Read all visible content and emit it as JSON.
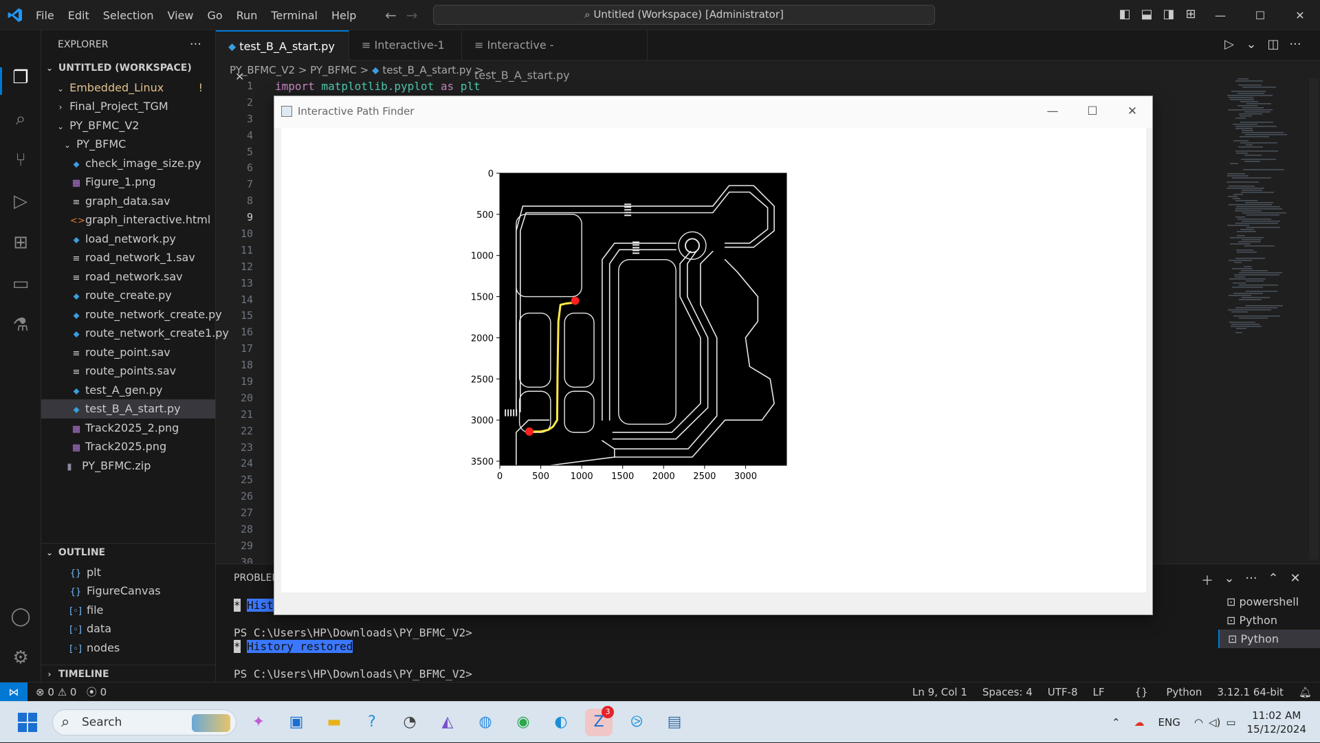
{
  "titlebar": {
    "menu": [
      "File",
      "Edit",
      "Selection",
      "View",
      "Go",
      "Run",
      "Terminal",
      "Help"
    ],
    "command_center": "Untitled (Workspace) [Administrator]",
    "window_controls": {
      "minimize": "—",
      "maximize": "☐",
      "close": "✕"
    }
  },
  "explorer": {
    "header": "EXPLORER",
    "more": "···",
    "workspace": "UNTITLED (WORKSPACE)",
    "folders": [
      {
        "name": "Embedded_Linux",
        "modified": "!"
      },
      {
        "name": "Final_Project_TGM"
      },
      {
        "name": "PY_BFMC_V2"
      },
      {
        "name": "PY_BFMC"
      }
    ],
    "files": [
      {
        "name": "check_image_size.py",
        "type": "python"
      },
      {
        "name": "Figure_1.png",
        "type": "image"
      },
      {
        "name": "graph_data.sav",
        "type": "text"
      },
      {
        "name": "graph_interactive.html",
        "type": "html"
      },
      {
        "name": "load_network.py",
        "type": "python"
      },
      {
        "name": "road_network_1.sav",
        "type": "text"
      },
      {
        "name": "road_network.sav",
        "type": "text"
      },
      {
        "name": "route_create.py",
        "type": "python"
      },
      {
        "name": "route_network_create.py",
        "type": "python"
      },
      {
        "name": "route_network_create1.py",
        "type": "python"
      },
      {
        "name": "route_point.sav",
        "type": "text"
      },
      {
        "name": "route_points.sav",
        "type": "text"
      },
      {
        "name": "test_A_gen.py",
        "type": "python"
      },
      {
        "name": "test_B_A_start.py",
        "type": "python"
      },
      {
        "name": "Track2025_2.png",
        "type": "image"
      },
      {
        "name": "Track2025.png",
        "type": "image"
      }
    ],
    "zip": "PY_BFMC.zip",
    "outline_header": "OUTLINE",
    "outline": [
      {
        "name": "plt",
        "icon": "{}"
      },
      {
        "name": "FigureCanvas",
        "icon": "{}"
      },
      {
        "name": "file",
        "icon": "[◦]"
      },
      {
        "name": "data",
        "icon": "[◦]"
      },
      {
        "name": "nodes",
        "icon": "[◦]"
      }
    ],
    "timeline_header": "TIMELINE"
  },
  "tabs": [
    {
      "label": "test_B_A_start.py",
      "icon": "python-icon"
    },
    {
      "label": "Interactive-1",
      "icon": "interactive-icon"
    },
    {
      "label": "Interactive - test_B_A_start.py",
      "icon": "interactive-icon"
    }
  ],
  "breadcrumb": {
    "parts": [
      "PY_BFMC_V2",
      "PY_BFMC",
      "test_B_A_start.py",
      "..."
    ],
    "sep": ">"
  },
  "code": {
    "line1": {
      "kw1": "import",
      "mod": "matplotlib.pyplot",
      "kw2": "as",
      "alias": "plt"
    },
    "line_numbers": [
      "1",
      "2",
      "3",
      "4",
      "5",
      "6",
      "7",
      "8",
      "9",
      "10",
      "11",
      "12",
      "13",
      "14",
      "15",
      "16",
      "17",
      "18",
      "19",
      "20",
      "21",
      "22",
      "23",
      "24",
      "25",
      "26",
      "27",
      "28",
      "29",
      "30"
    ]
  },
  "panel": {
    "title": "PROBLEM",
    "star": "*",
    "hist_short": "Hist",
    "prompt": "PS C:\\Users\\HP\\Downloads\\PY_BFMC_V2>",
    "history_restored": "History restored",
    "terminals": [
      "powershell",
      "Python",
      "Python"
    ]
  },
  "statusbar": {
    "errors": "0",
    "warnings": "0",
    "ports": "0",
    "position": "Ln 9, Col 1",
    "spaces": "Spaces: 4",
    "encoding": "UTF-8",
    "eol": "LF",
    "language": "Python",
    "interpreter": "3.12.1 64-bit"
  },
  "taskbar": {
    "search": "Search",
    "badge": "3",
    "lang": "ENG",
    "time": "11:02 AM",
    "date": "15/12/2024"
  },
  "pathfinder": {
    "title": "Interactive Path Finder",
    "controls": {
      "minimize": "—",
      "maximize": "☐",
      "close": "✕"
    }
  },
  "chart_data": {
    "type": "image",
    "xlim": [
      0,
      3500
    ],
    "ylim": [
      3550,
      0
    ],
    "xticks": [
      0,
      500,
      1000,
      1500,
      2000,
      2500,
      3000
    ],
    "yticks": [
      0,
      500,
      1000,
      1500,
      2000,
      2500,
      3000,
      3500
    ],
    "xtick_labels": [
      "0",
      "500",
      "1000",
      "1500",
      "2000",
      "2500",
      "3000"
    ],
    "ytick_labels": [
      "0",
      "500",
      "1000",
      "1500",
      "2000",
      "2500",
      "3000",
      "3500"
    ],
    "path": [
      [
        920,
        1550
      ],
      [
        880,
        1575
      ],
      [
        800,
        1585
      ],
      [
        740,
        1600
      ],
      [
        715,
        1800
      ],
      [
        705,
        2400
      ],
      [
        700,
        3000
      ],
      [
        650,
        3080
      ],
      [
        590,
        3120
      ],
      [
        500,
        3140
      ],
      [
        360,
        3140
      ]
    ],
    "start": [
      920,
      1550
    ],
    "goal": [
      360,
      3140
    ],
    "colors": {
      "background": "#000000",
      "road": "#e8e8e8",
      "path": "#ffe94a",
      "marker": "#ff2020"
    }
  }
}
